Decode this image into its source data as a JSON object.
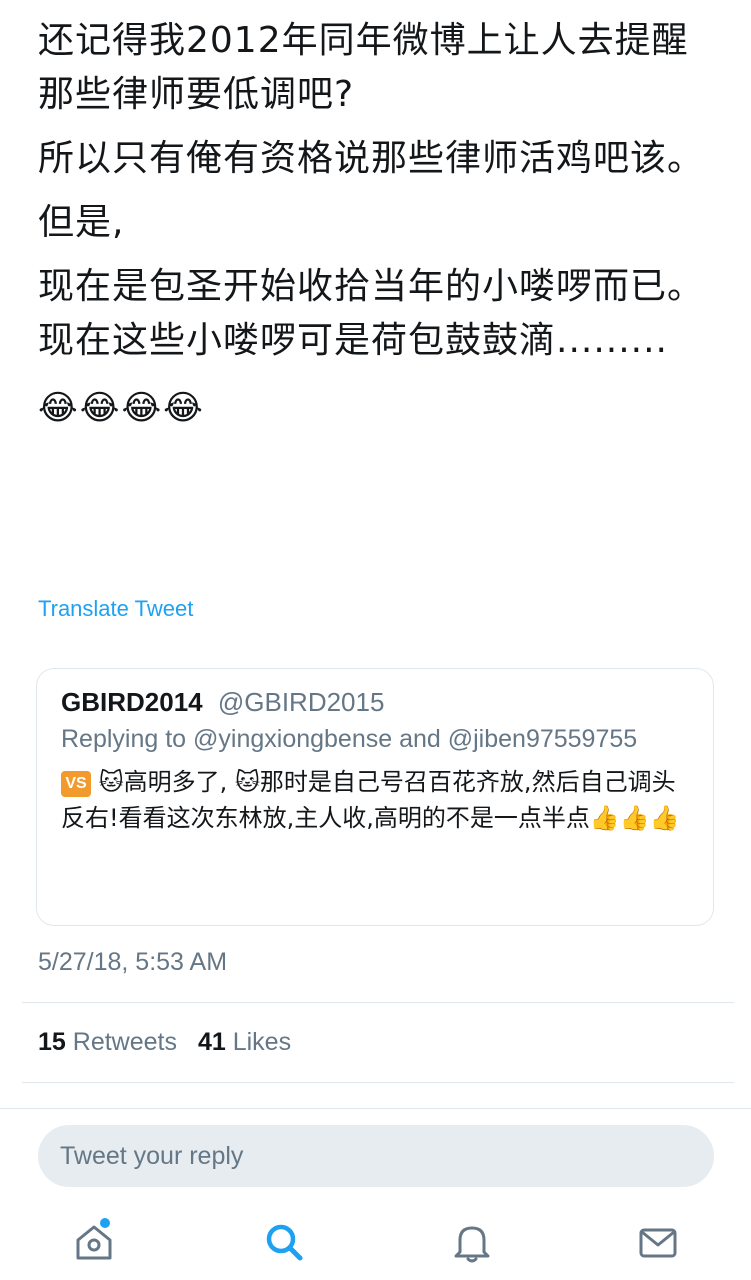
{
  "tweet": {
    "paragraphs": [
      "还记得我2012年同年微博上让人去提醒那些律师要低调吧?",
      "所以只有俺有资格说那些律师活鸡吧该。",
      "但是,",
      "现在是包圣开始收拾当年的小喽啰而已。现在这些小喽啰可是荷包鼓鼓滴.........",
      "😂😂😂😂"
    ],
    "translate_label": "Translate Tweet",
    "timestamp": "5/27/18, 5:53 AM"
  },
  "quoted_tweet": {
    "display_name": "GBIRD2014",
    "handle": "@GBIRD2015",
    "replying_to": "Replying to @yingxiongbense and @jiben97559755",
    "vs_badge": "VS",
    "text": "🐱高明多了, 🐱那时是自己号召百花齐放,然后自己调头反右!看看这次东林放,主人收,高明的不是一点半点👍👍👍"
  },
  "stats": {
    "retweets_count": "15",
    "retweets_label": "Retweets",
    "likes_count": "41",
    "likes_label": "Likes"
  },
  "reply": {
    "placeholder": "Tweet your reply"
  },
  "tabbar": {
    "icons": [
      "home-icon",
      "search-icon",
      "bell-icon",
      "mail-icon"
    ]
  },
  "colors": {
    "accent": "#1da1f2",
    "secondary_text": "#657786",
    "primary_text": "#14171a",
    "divider": "#e1e8ed",
    "reply_bg": "#e6ecf0"
  }
}
